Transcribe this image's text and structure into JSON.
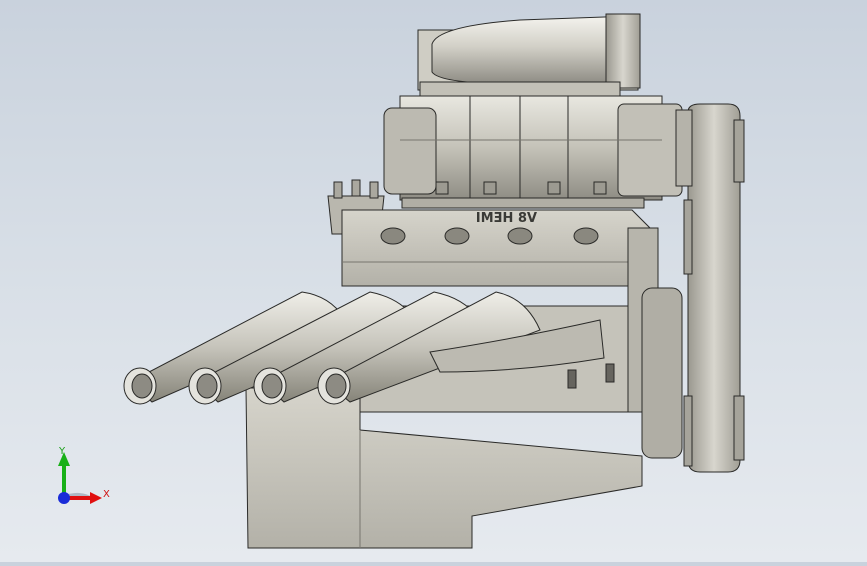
{
  "model": {
    "engraving": "V8 HEMI"
  },
  "triad": {
    "x_label": "X",
    "y_label": "Y",
    "x_color": "#e01010",
    "y_color": "#18b018",
    "z_color": "#1a2cd8"
  },
  "colors": {
    "background_top": "#c9d2dd",
    "background_bottom": "#e6eaef",
    "metal": "#c8c6bc",
    "edges": "#2a2a28"
  }
}
